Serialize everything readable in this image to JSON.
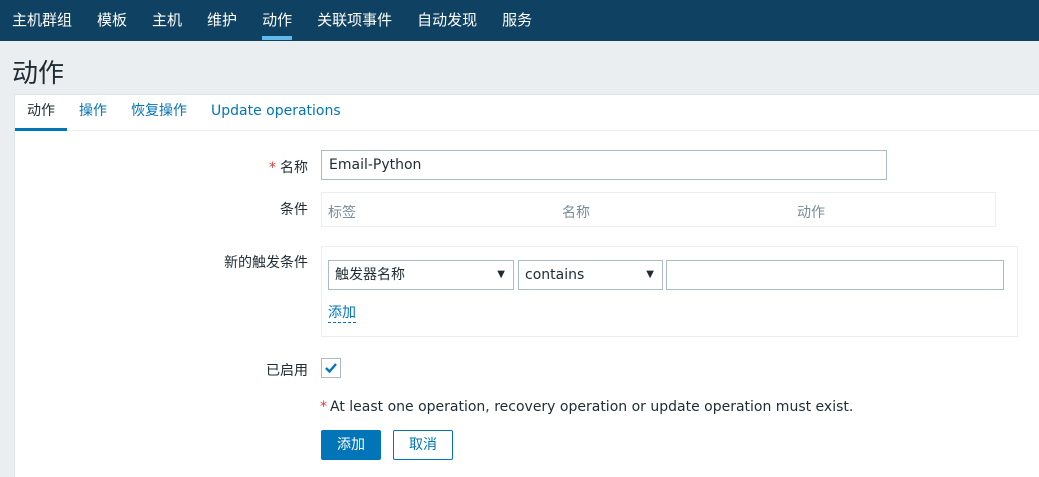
{
  "nav": {
    "items": [
      {
        "label": "主机群组",
        "active": false
      },
      {
        "label": "模板",
        "active": false
      },
      {
        "label": "主机",
        "active": false
      },
      {
        "label": "维护",
        "active": false
      },
      {
        "label": "动作",
        "active": true
      },
      {
        "label": "关联项事件",
        "active": false
      },
      {
        "label": "自动发现",
        "active": false
      },
      {
        "label": "服务",
        "active": false
      }
    ]
  },
  "page": {
    "title": "动作"
  },
  "tabs": [
    {
      "label": "动作",
      "active": true
    },
    {
      "label": "操作",
      "active": false
    },
    {
      "label": "恢复操作",
      "active": false
    },
    {
      "label": "Update operations",
      "active": false
    }
  ],
  "form": {
    "required_mark": "*",
    "name_label": "名称",
    "name_value": "Email-Python",
    "conditions_label": "条件",
    "conditions_headers": [
      "标签",
      "名称",
      "动作"
    ],
    "new_condition_label": "新的触发条件",
    "condition_type": "触发器名称",
    "condition_operator": "contains",
    "condition_value": "",
    "add_link": "添加",
    "enabled_label": "已启用",
    "enabled": true,
    "note_text": "At least one operation, recovery operation or update operation must exist.",
    "add_button": "添加",
    "cancel_button": "取消"
  },
  "colors": {
    "nav_bg": "#0f4262",
    "accent": "#0275b8",
    "required": "#e33734"
  }
}
